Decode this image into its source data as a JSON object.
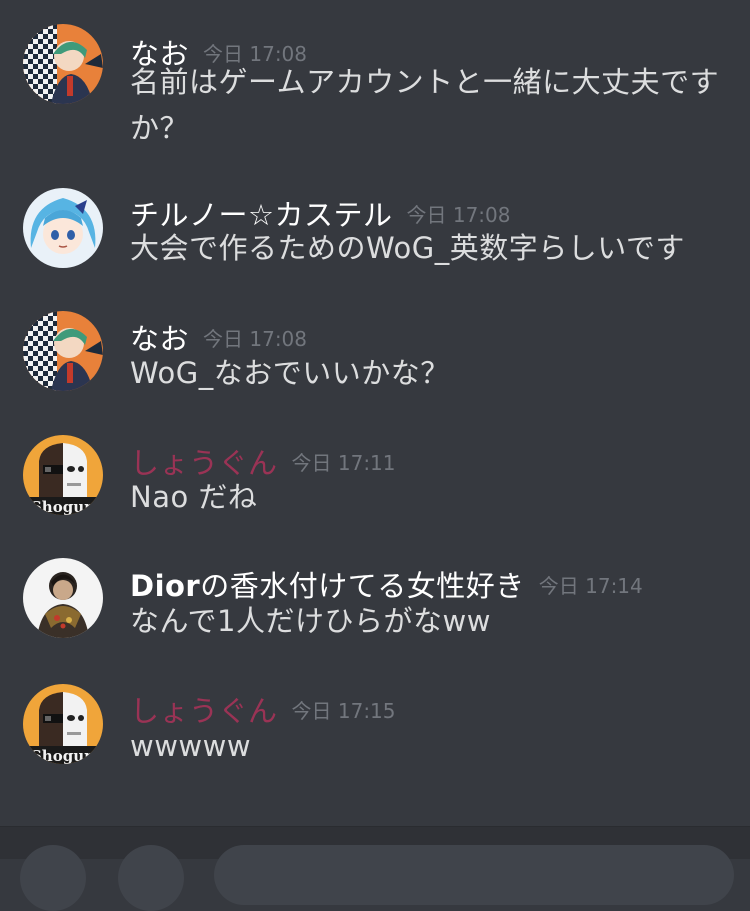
{
  "messages": [
    {
      "avatar": "checkered-avatar",
      "name": "なお",
      "timestamp": "今日 17:08",
      "text": "名前はゲームアカウントと一緒に大丈夫ですか？"
    },
    {
      "avatar": "blue-hair-avatar",
      "name": "チルノー☆カステル",
      "timestamp": "今日 17:08",
      "text": "大会で作るためのWoG_英数字らしいです"
    },
    {
      "avatar": "checkered-avatar",
      "name": "なお",
      "timestamp": "今日 17:08",
      "text": "WoG_なおでいいかな？"
    },
    {
      "avatar": "mask-avatar",
      "name": "しょうぐん",
      "name_color": "#9a3355",
      "timestamp": "今日 17:11",
      "text": "Nao だね"
    },
    {
      "avatar": "dark-avatar",
      "name_prefix": "Dior",
      "name_rest": "の香水付けてる女性好き",
      "timestamp": "今日 17:14",
      "text": "なんで1人だけひらがなww"
    },
    {
      "avatar": "mask-avatar",
      "name": "しょうぐん",
      "name_color": "#9a3355",
      "timestamp": "今日 17:15",
      "text": "wwwww"
    }
  ],
  "avatar_text": {
    "mask": "Shogun"
  },
  "colors": {
    "background": "#36393f",
    "name": "#ffffff",
    "timestamp": "#72767d",
    "text": "#dcddde",
    "role_pink": "#9a3355"
  }
}
